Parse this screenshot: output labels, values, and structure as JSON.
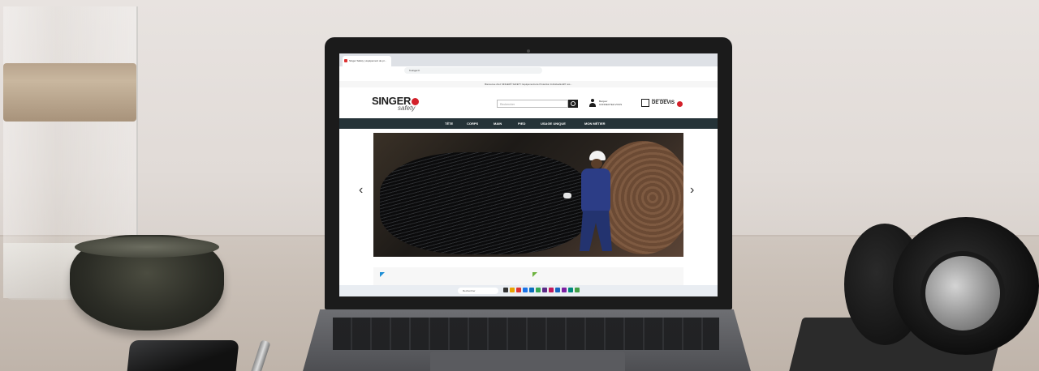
{
  "browser": {
    "tab_title": "Singer Safety | équipement de pr...",
    "address": "fr.singer.fr"
  },
  "site": {
    "topbar_text": "Bienvenue chez SINGER® SAFETY. Equipements de Protection Individuelle EPI nos...",
    "logo_main": "SINGER",
    "logo_sub": "safety",
    "search_placeholder": "Rechercher",
    "account_line1": "Bonjour",
    "account_line2": "CONNECTEZ-VOUS",
    "quote_line1": "MA DEMANDE",
    "quote_line2": "DE DEVIS",
    "nav": [
      "TÊTE",
      "CORPS",
      "MAIN",
      "PIED",
      "USAGE UNIQUE",
      "MON MÉTIER"
    ],
    "colors": {
      "nav_bg": "#253338",
      "accent_red": "#d3202a",
      "blue_triangle": "#1f8fd6",
      "green_triangle": "#6db33f"
    },
    "slider_prev_icon": "chevron-left-icon",
    "slider_next_icon": "chevron-right-icon"
  },
  "taskbar": {
    "search_label": "Rechercher"
  }
}
